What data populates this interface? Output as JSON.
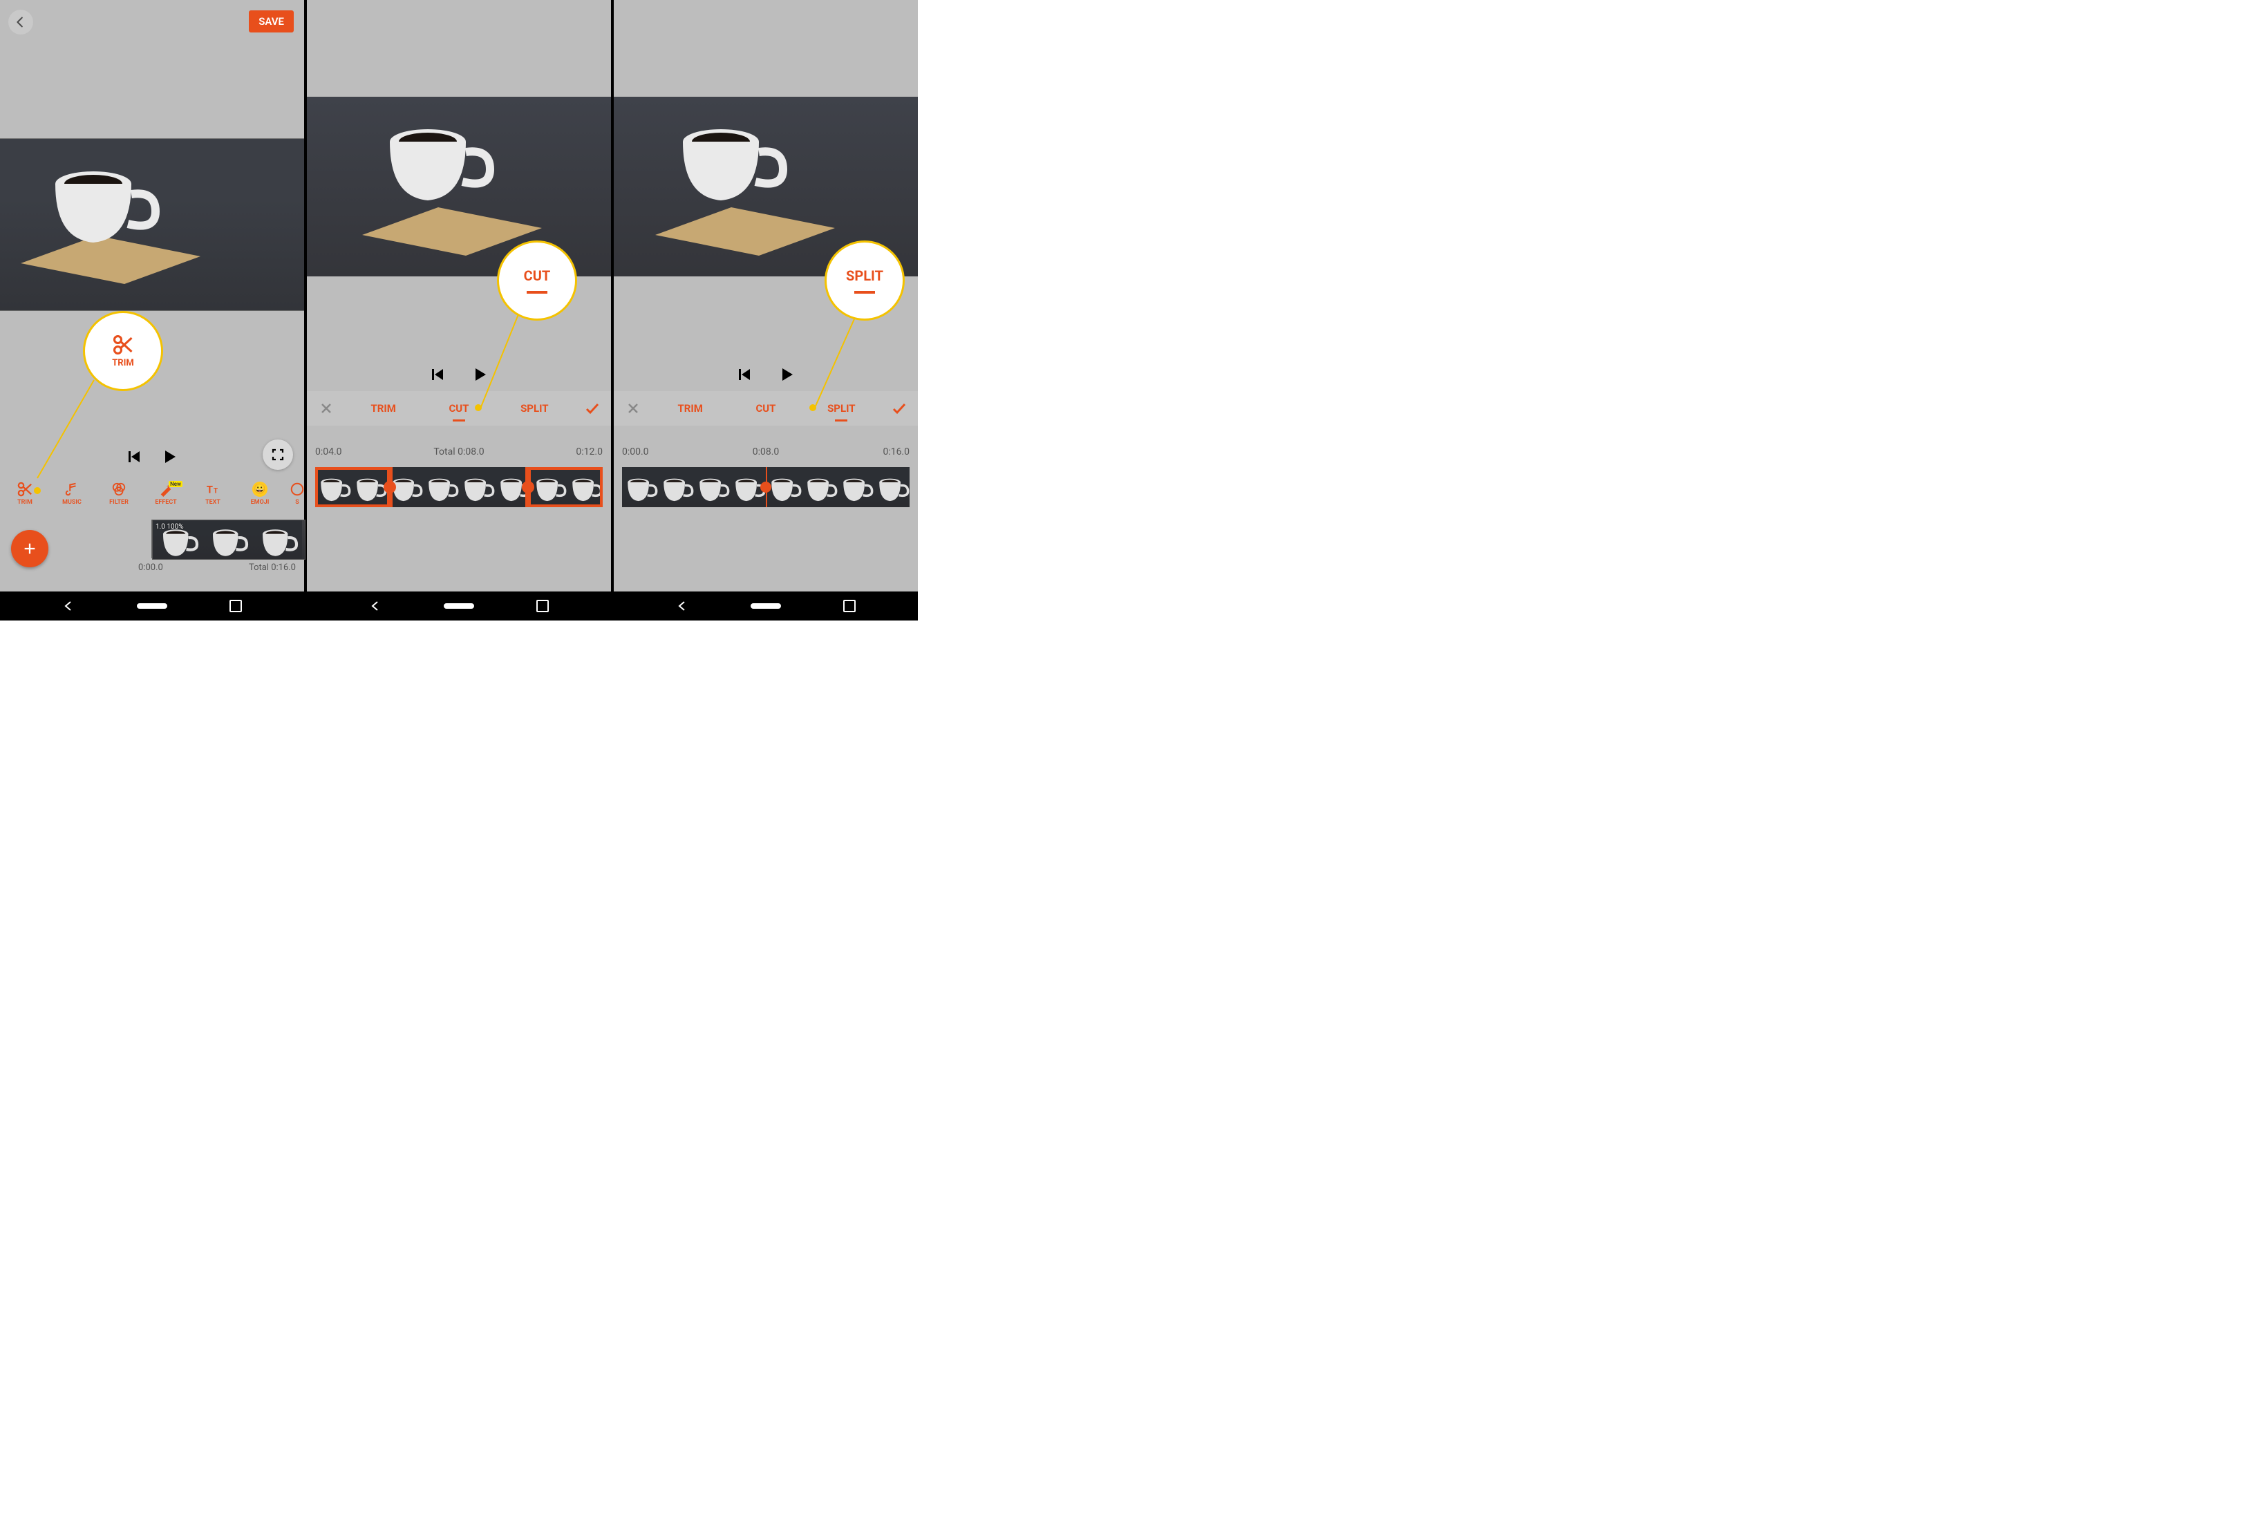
{
  "left": {
    "save_label": "SAVE",
    "tools": [
      {
        "id": "trim",
        "label": "TRIM"
      },
      {
        "id": "music",
        "label": "MUSIC"
      },
      {
        "id": "filter",
        "label": "FILTER"
      },
      {
        "id": "effect",
        "label": "EFFECT",
        "badge": "New"
      },
      {
        "id": "text",
        "label": "TEXT"
      },
      {
        "id": "emoji",
        "label": "EMOJI"
      },
      {
        "id": "speed",
        "label": "S"
      }
    ],
    "timeline": {
      "pct_label": "1.0 100%",
      "start": "0:00.0",
      "total": "Total 0:16.0"
    },
    "callout_label": "TRIM"
  },
  "center": {
    "tabs": {
      "trim": "TRIM",
      "cut": "CUT",
      "split": "SPLIT",
      "active": "cut"
    },
    "times": {
      "left": "0:04.0",
      "mid": "Total 0:08.0",
      "right": "0:12.0"
    },
    "callout_label": "CUT"
  },
  "right": {
    "tabs": {
      "trim": "TRIM",
      "cut": "CUT",
      "split": "SPLIT",
      "active": "split"
    },
    "times": {
      "left": "0:00.0",
      "mid": "0:08.0",
      "right": "0:16.0"
    },
    "callout_label": "SPLIT"
  }
}
